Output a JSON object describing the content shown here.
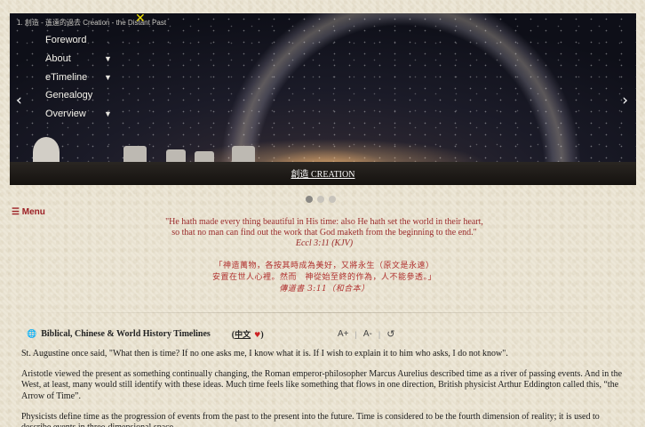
{
  "slider": {
    "breadcrumb": "1. 創造 - 遙遠的過去 Creation - the Distant Past",
    "close_icon": "✕",
    "prev_icon": "‹",
    "next_icon": "›",
    "caption": "創造 CREATION",
    "dots": 3,
    "active_dot": 0
  },
  "nav": {
    "items": [
      {
        "label": "Foreword",
        "has_caret": false
      },
      {
        "label": "About",
        "has_caret": true
      },
      {
        "label": "eTimeline",
        "has_caret": true
      },
      {
        "label": "Genealogy",
        "has_caret": false
      },
      {
        "label": "Overview",
        "has_caret": true
      }
    ],
    "caret_icon": "▼"
  },
  "menu_button": "☰ Menu",
  "quote_en": {
    "line1": "\"He hath made every thing beautiful in His time: also He hath set the world in their heart,",
    "line2": "so that no man can find out the work that God maketh from the beginning to the end.\"",
    "ref": "Eccl 3:11 (KJV)"
  },
  "quote_zh": {
    "line1": "「神造萬物，各按其時成為美好，又將永生（原文是永遠）",
    "line2": "安置在世人心裡。然而　神從始至終的作為，人不能參透。」",
    "ref": "傳道書 3:11（和合本）"
  },
  "header": {
    "globe_icon": "🌐",
    "title": "Biblical, Chinese & World History Timelines",
    "lang_open": "(",
    "lang_link": "中文",
    "heart_icon": "♥",
    "lang_close": ")",
    "font_increase": "A+",
    "font_decrease": "A-",
    "reset_icon": "↺"
  },
  "article": {
    "p1": "St. Augustine once said, \"What then is time? If no one asks me, I know what it is. If I wish to explain it to him who asks, I do not know\".",
    "p2": "Aristotle viewed the present as something continually changing, the Roman emperor-philosopher Marcus Aurelius described time as a river of passing events. And in the West, at least, many would still identify with these ideas. Much time feels like something that flows in one direction, British physicist Arthur Eddington called this, “the Arrow of Time”.",
    "p3": "Physicists define time as the progression of events from the past to the present into the future. Time is considered to be the fourth dimension of reality; it is used to describe events in three-dimensional space."
  }
}
